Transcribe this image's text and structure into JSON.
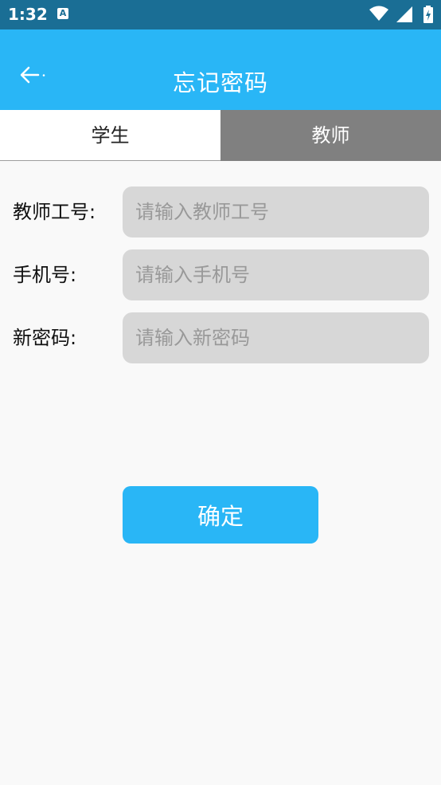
{
  "status_bar": {
    "time": "1:32",
    "notification_icon": "a-icon",
    "icons": [
      "wifi-icon",
      "signal-icon",
      "battery-charging-icon"
    ]
  },
  "app_bar": {
    "back_icon": "arrow-left-icon",
    "title": "忘记密码"
  },
  "tabs": [
    {
      "label": "学生",
      "selected": false
    },
    {
      "label": "教师",
      "selected": true
    }
  ],
  "form": {
    "teacher_id": {
      "label": "教师工号:",
      "placeholder": "请输入教师工号",
      "value": ""
    },
    "phone": {
      "label": "手机号:",
      "placeholder": "请输入手机号",
      "value": ""
    },
    "new_password": {
      "label": "新密码:",
      "placeholder": "请输入新密码",
      "value": ""
    }
  },
  "confirm_button": {
    "label": "确定"
  },
  "colors": {
    "status_bar": "#1a6e95",
    "accent": "#29b6f6",
    "tab_selected_bg": "#808080",
    "input_bg": "#d7d7d7",
    "background": "#f9f9f9"
  }
}
